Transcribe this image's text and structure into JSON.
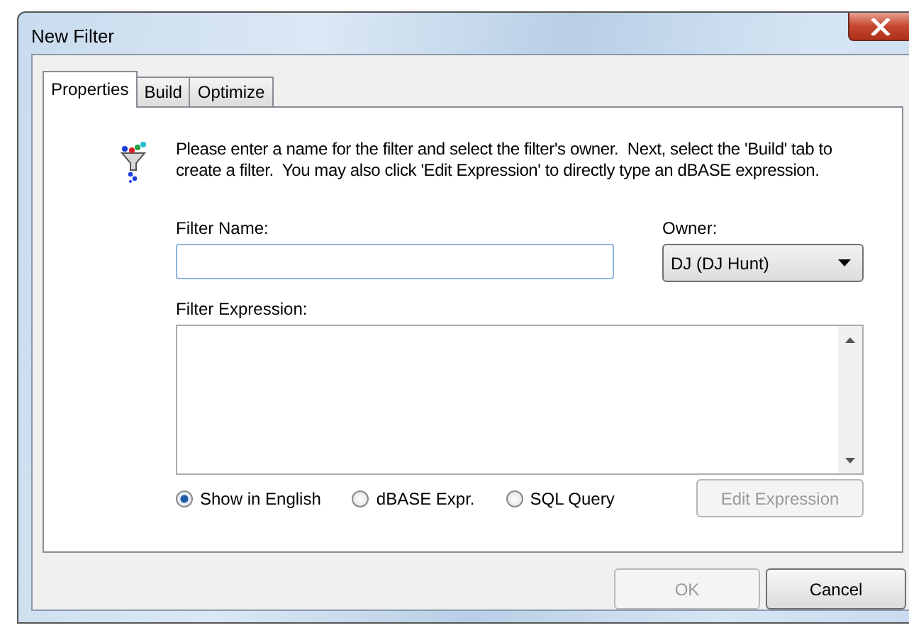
{
  "window": {
    "title": "New Filter"
  },
  "tabs": [
    {
      "label": "Properties",
      "selected": true
    },
    {
      "label": "Build",
      "selected": false
    },
    {
      "label": "Optimize",
      "selected": false
    }
  ],
  "description": "Please enter a name for the filter and select the filter's owner.  Next, select the 'Build' tab to create a filter.  You may also click 'Edit Expression' to directly type an dBASE expression.",
  "filter_name": {
    "label": "Filter Name:"
  },
  "owner": {
    "label": "Owner:",
    "value": "DJ (DJ Hunt)"
  },
  "expression": {
    "label": "Filter Expression:"
  },
  "display_modes": [
    {
      "label": "Show in English",
      "selected": true
    },
    {
      "label": "dBASE Expr.",
      "selected": false
    },
    {
      "label": "SQL Query",
      "selected": false
    }
  ],
  "edit_button": {
    "label": "Edit Expression",
    "disabled": true
  },
  "buttons": [
    {
      "label": "OK",
      "disabled": true
    },
    {
      "label": "Cancel",
      "disabled": false
    }
  ]
}
